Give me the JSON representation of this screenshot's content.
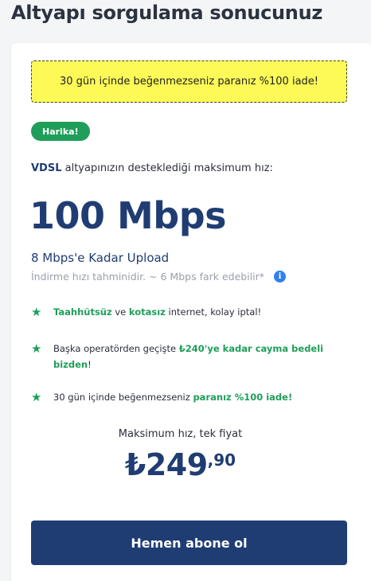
{
  "page": {
    "title": "Altyapı sorgulama sonucunuz"
  },
  "promo": {
    "text": "30 gün içinde beğenmezseniz paranız %100 iade!"
  },
  "badge": {
    "label": "Harika!"
  },
  "infra": {
    "prefix": "VDSL",
    "text": " altyapınızın desteklediği maksimum hız:"
  },
  "speed": {
    "value": "100 Mbps"
  },
  "upload": {
    "text": "8 Mbps'e Kadar Upload"
  },
  "estimate": {
    "text": "İndirme hızı tahminidir. ~ 6 Mbps fark edebilir*",
    "icon": "info-icon"
  },
  "features": [
    {
      "parts": [
        "",
        "Taahhütsüz",
        " ve ",
        "kotasız",
        " internet, kolay iptal!"
      ]
    },
    {
      "parts": [
        "Başka operatörden geçişte ",
        "₺240'ye kadar cayma bedeli bizden",
        "!"
      ]
    },
    {
      "parts": [
        "30 gün içinde beğenmezseniz ",
        "paranız %100 iade!"
      ]
    }
  ],
  "price": {
    "caption": "Maksimum hız, tek fiyat",
    "main": "₺249",
    "cents": ",90"
  },
  "cta": {
    "label": "Hemen abone ol"
  },
  "colors": {
    "navy": "#1f3d73",
    "green": "#1f9e59",
    "promo_bg": "#fdfa57",
    "info_blue": "#2f80ed"
  }
}
